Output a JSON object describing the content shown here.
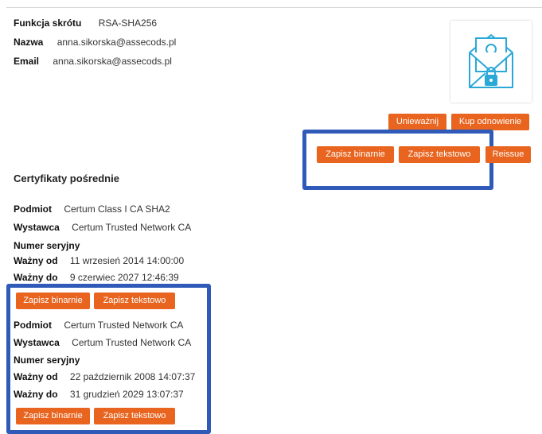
{
  "certificate": {
    "hash_label": "Funkcja skrótu",
    "hash_value": "RSA-SHA256",
    "name_label": "Nazwa",
    "name_value": "anna.sikorska@assecods.pl",
    "email_label": "Email",
    "email_value": "anna.sikorska@assecods.pl",
    "icon": "envelope-certificate-icon"
  },
  "actions": {
    "revoke_label": "Unieważnij",
    "renew_label": "Kup odnowienie",
    "save_binary_label": "Zapisz binarnie",
    "save_text_label": "Zapisz tekstowo",
    "reissue_label": "Reissue"
  },
  "intermediate": {
    "title": "Certyfikaty pośrednie",
    "subject_label": "Podmiot",
    "issuer_label": "Wystawca",
    "serial_label": "Numer seryjny",
    "valid_from_label": "Ważny od",
    "valid_to_label": "Ważny do",
    "save_binary_label": "Zapisz binarnie",
    "save_text_label": "Zapisz tekstowo",
    "certs": [
      {
        "subject": "Certum Class I CA SHA2",
        "issuer": "Certum Trusted Network CA",
        "valid_from": "11 wrzesień 2014 14:00:00",
        "valid_to": "9 czerwiec 2027 12:46:39"
      },
      {
        "subject": "Certum Trusted Network CA",
        "issuer": "Certum Trusted Network CA",
        "valid_from": "22 październik 2008 14:07:37",
        "valid_to": "31 grudzień 2029 13:07:37"
      }
    ]
  },
  "colors": {
    "accent": "#e8641f",
    "highlight": "#2f5ab8",
    "icon": "#2aa8d8"
  }
}
